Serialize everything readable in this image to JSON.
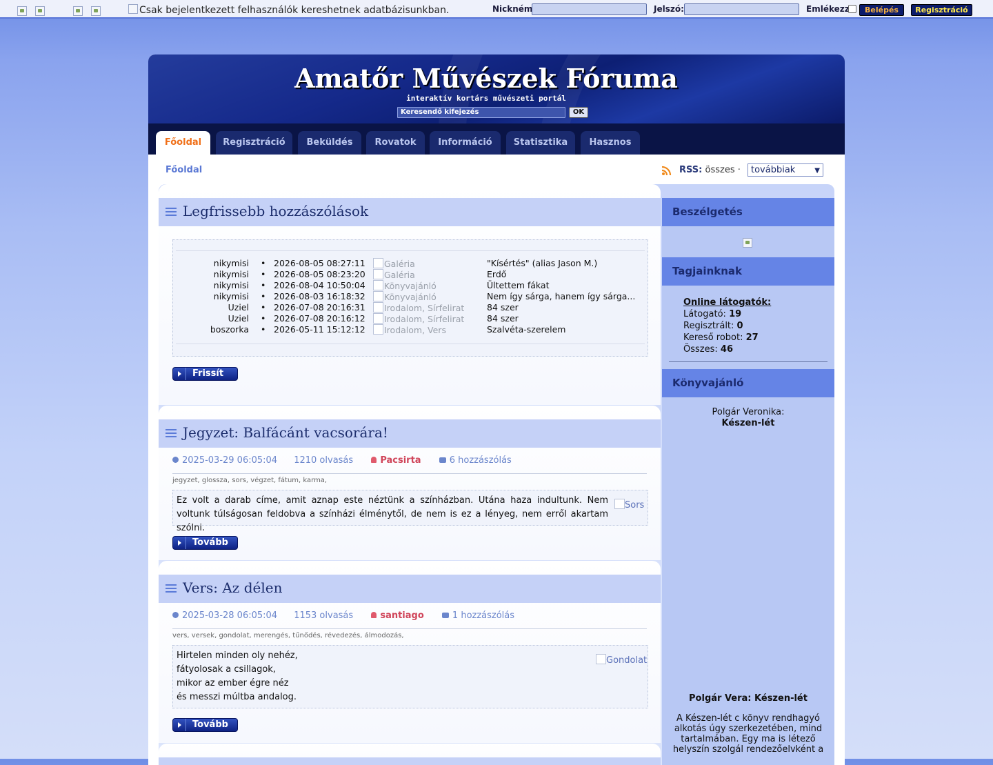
{
  "topbar": {
    "search_note": "Csak bejelentkezett felhasználók kereshetnek adatbázisunkban.",
    "nick_label": "Nickném:",
    "password_label": "Jelszó:",
    "remember_label": "Emlékezz",
    "login_button": "Belépés",
    "register_button": "Regisztráció",
    "colors": {
      "login_text": "#f5b041",
      "register_text": "#ffe94d"
    }
  },
  "header": {
    "title": "Amatőr Művészek Fóruma",
    "subtitle": "interaktív kortárs művészeti portál",
    "search_placeholder": "Keresendő kifejezés",
    "search_button": "OK"
  },
  "nav": {
    "tabs": [
      {
        "label": "Főoldal",
        "active": true
      },
      {
        "label": "Regisztráció"
      },
      {
        "label": "Beküldés"
      },
      {
        "label": "Rovatok"
      },
      {
        "label": "Információ"
      },
      {
        "label": "Statisztika"
      },
      {
        "label": "Hasznos"
      }
    ]
  },
  "breadcrumb": "Főoldal",
  "rss": {
    "label": "RSS:",
    "all": "összes ·",
    "select_value": "továbbiak"
  },
  "latest_comments": {
    "title": "Legfrissebb hozzászólások",
    "refresh_button": "Frissít",
    "rows": [
      {
        "user": "nikymisi",
        "time": "2026-08-05 08:27:11",
        "category": "Galéria",
        "title": "\"Kísértés\" (alias Jason M.)"
      },
      {
        "user": "nikymisi",
        "time": "2026-08-05 08:23:20",
        "category": "Galéria",
        "title": "Erdő"
      },
      {
        "user": "nikymisi",
        "time": "2026-08-04 10:50:04",
        "category": "Könyvajánló",
        "title": "Ültettem fákat"
      },
      {
        "user": "nikymisi",
        "time": "2026-08-03 16:18:32",
        "category": "Könyvajánló",
        "title": "Nem így sárga, hanem így sárga..."
      },
      {
        "user": "Uziel",
        "time": "2026-07-08 20:16:31",
        "category": "Irodalom, Sírfelirat",
        "title": "84 szer"
      },
      {
        "user": "Uziel",
        "time": "2026-07-08 20:16:12",
        "category": "Irodalom, Sírfelirat",
        "title": "84 szer"
      },
      {
        "user": "boszorka",
        "time": "2026-05-11 15:12:12",
        "category": "Irodalom, Vers",
        "title": "Szalvéta-szerelem"
      }
    ]
  },
  "articles": [
    {
      "title": "Jegyzet: Balfácánt vacsorára!",
      "date": "2025-03-29 06:05:04",
      "reads": "1210 olvasás",
      "author": "Pacsirta",
      "comments": "6 hozzászólás",
      "tags": "jegyzet, glossza, sors, végzet, fátum, karma,",
      "excerpt": "Ez volt a darab címe, amit aznap este néztünk a színházban. Utána haza indultunk. Nem voltunk túlságosan feldobva a színházi élménytől, de nem is ez a lényeg, nem erről akartam szólni.",
      "image_alt": "Sors",
      "more_button": "Tovább"
    },
    {
      "title": "Vers: Az délen",
      "date": "2025-03-28 06:05:04",
      "reads": "1153 olvasás",
      "author": "santiago",
      "comments": "1 hozzászólás",
      "tags": "vers, versek, gondolat, merengés, tűnődés, révedezés, álmodozás,",
      "lines": [
        "Hirtelen minden oly nehéz,",
        "fátyolosak a csillagok,",
        "mikor az ember égre néz",
        "és messzi múltba andalog."
      ],
      "image_alt": "Gondolat",
      "more_button": "Tovább"
    }
  ],
  "sidebar": {
    "chat_title": "Beszélgetés",
    "members_title": "Tagjainknak",
    "online_label": "Online látogatók:",
    "stats": [
      {
        "label": "Látogató:",
        "value": "19"
      },
      {
        "label": "Regisztrált:",
        "value": "0"
      },
      {
        "label": "Kereső robot:",
        "value": "27"
      },
      {
        "label": "Összes:",
        "value": "46"
      }
    ],
    "book_title": "Könyvajánló",
    "book_author": "Polgár Veronika:",
    "book_name": "Készen-lét",
    "book_heading": "Polgár Vera: Készen-lét",
    "book_desc_lines": [
      "A Készen-lét c könyv rendhagyó",
      "alkotás úgy szerkezetében, mind",
      "tartalmában. Egy ma is létező",
      "helyszín szolgál rendezőelvként a"
    ]
  }
}
